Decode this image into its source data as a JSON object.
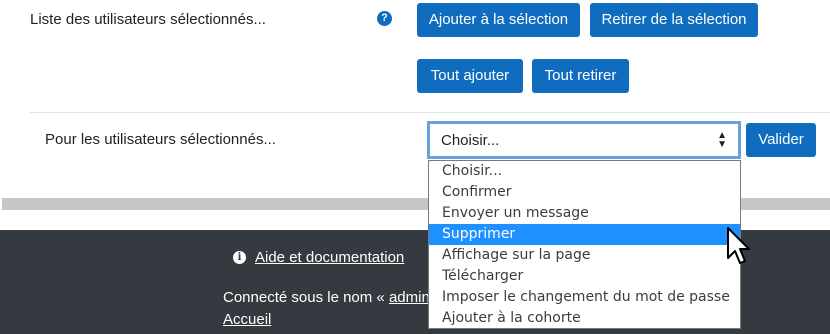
{
  "user_list": {
    "label": "Liste des utilisateurs sélectionnés...",
    "help_icon": "question-circle-icon",
    "help_glyph": "?",
    "buttons": {
      "add_selection": "Ajouter à la sélection",
      "remove_selection": "Retirer de la sélection",
      "add_all": "Tout ajouter",
      "remove_all": "Tout retirer"
    }
  },
  "bulk_action": {
    "label": "Pour les utilisateurs sélectionnés...",
    "select_value": "Choisir...",
    "caret": "▲▼",
    "submit": "Valider",
    "options": [
      "Choisir...",
      "Confirmer",
      "Envoyer un message",
      "Supprimer",
      "Affichage sur la page",
      "Télécharger",
      "Imposer le changement du mot de passe",
      "Ajouter à la cohorte"
    ],
    "highlighted_option": "Supprimer"
  },
  "footer": {
    "info_icon": "info-circle-icon",
    "info_glyph": "i",
    "help_link": "Aide et documentation",
    "logged_in_prefix": "Connecté sous le nom «",
    "user_link": "admin",
    "home_link": "Accueil"
  },
  "colors": {
    "primary": "#0f6cbf",
    "footer_bg": "#343a40",
    "highlight": "#1e90ff"
  }
}
